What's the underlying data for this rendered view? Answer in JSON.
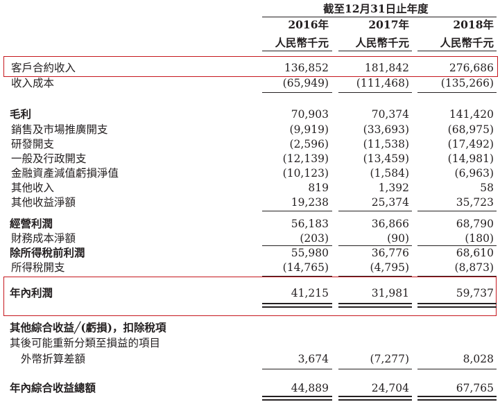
{
  "header": {
    "period": "截至12月31日止年度",
    "years": [
      "2016年",
      "2017年",
      "2018年"
    ],
    "unit": "人民幣千元"
  },
  "rows": [
    {
      "label": "客戶合約收入",
      "values": [
        "136,852",
        "181,842",
        "276,686"
      ]
    },
    {
      "label": "收入成本",
      "values": [
        "(65,949)",
        "(111,468)",
        "(135,266)"
      ]
    },
    {
      "label": "毛利",
      "values": [
        "70,903",
        "70,374",
        "141,420"
      ]
    },
    {
      "label": "銷售及市場推廣開支",
      "values": [
        "(9,919)",
        "(33,693)",
        "(68,975)"
      ]
    },
    {
      "label": "研發開支",
      "values": [
        "(2,596)",
        "(11,538)",
        "(17,492)"
      ]
    },
    {
      "label": "一般及行政開支",
      "values": [
        "(12,139)",
        "(13,459)",
        "(14,981)"
      ]
    },
    {
      "label": "金融資產減值虧損淨值",
      "values": [
        "(10,123)",
        "(1,584)",
        "(6,963)"
      ]
    },
    {
      "label": "其他收入",
      "values": [
        "819",
        "1,392",
        "58"
      ]
    },
    {
      "label": "其他收益淨額",
      "values": [
        "19,238",
        "25,374",
        "35,723"
      ]
    },
    {
      "label": "經營利潤",
      "values": [
        "56,183",
        "36,866",
        "68,790"
      ]
    },
    {
      "label": "財務成本淨額",
      "values": [
        "(203)",
        "(90)",
        "(180)"
      ]
    },
    {
      "label": "除所得稅前利潤",
      "values": [
        "55,980",
        "36,776",
        "68,610"
      ]
    },
    {
      "label": "所得稅開支",
      "values": [
        "(14,765)",
        "(4,795)",
        "(8,873)"
      ]
    },
    {
      "label": "年內利潤",
      "values": [
        "41,215",
        "31,981",
        "59,737"
      ]
    },
    {
      "label": "其他綜合收益╱(虧損)，扣除稅項",
      "values": []
    },
    {
      "label": "其後可能重新分類至損益的項目",
      "values": []
    },
    {
      "label": "外幣折算差額",
      "values": [
        "3,674",
        "(7,277)",
        "8,028"
      ]
    },
    {
      "label": "年內綜合收益總額",
      "values": [
        "44,889",
        "24,704",
        "67,765"
      ]
    }
  ],
  "highlight_color": "#c5161d"
}
